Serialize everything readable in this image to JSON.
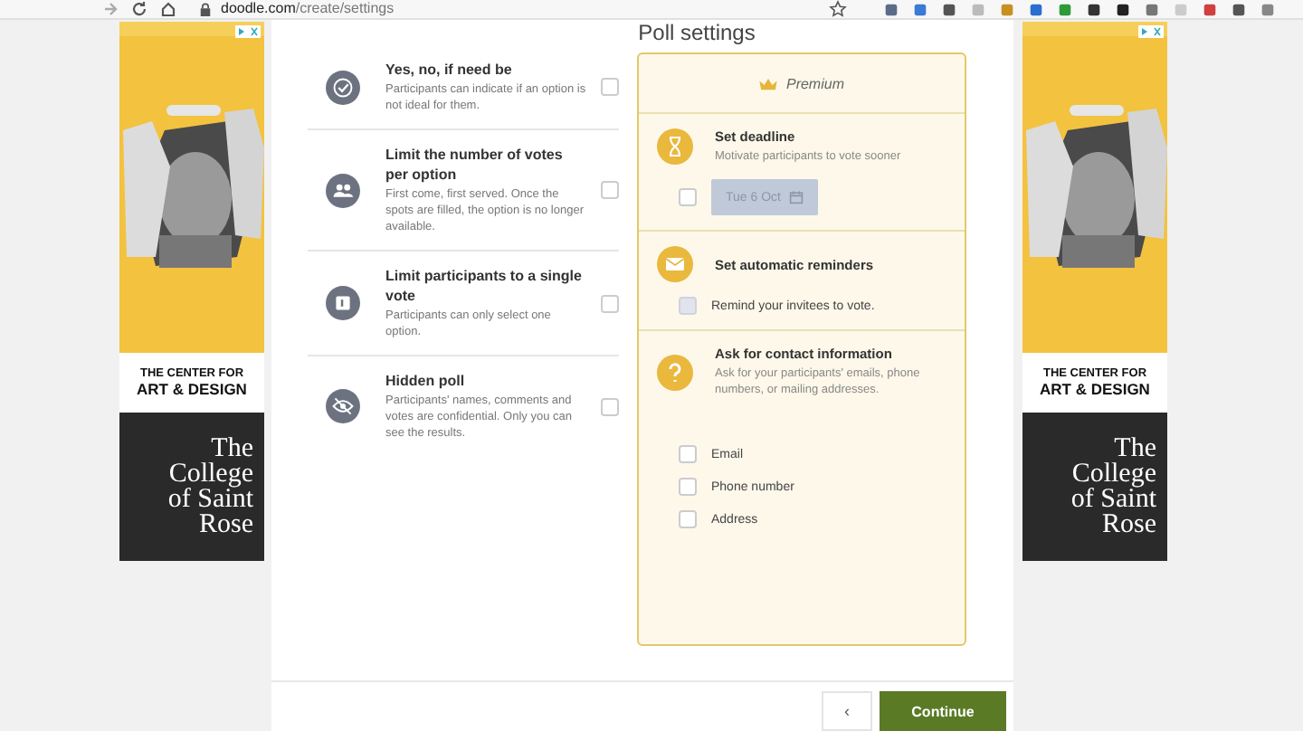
{
  "browser": {
    "url_host": "doodle.com",
    "url_path": "/create/settings"
  },
  "page": {
    "title": "Poll settings"
  },
  "options": [
    {
      "title": "Yes, no, if need be",
      "description": "Participants can indicate if an option is not ideal for them.",
      "checked": false
    },
    {
      "title": "Limit the number of votes per option",
      "description": "First come, first served. Once the spots are filled, the option is no longer available.",
      "checked": false
    },
    {
      "title": "Limit participants to a single vote",
      "description": "Participants can only select one option.",
      "checked": false
    },
    {
      "title": "Hidden poll",
      "description": "Participants' names, comments and votes are confidential. Only you can see the results.",
      "checked": false
    }
  ],
  "premium": {
    "label": "Premium",
    "sections": [
      {
        "kind": "deadline",
        "title": "Set deadline",
        "description": "Motivate participants to vote sooner",
        "checked": false,
        "date": "Tue 6 Oct",
        "date_disabled": true
      },
      {
        "kind": "reminder",
        "title": "Set automatic reminders",
        "checkbox_label": "Remind your invitees to vote.",
        "checked": false,
        "disabled": true
      },
      {
        "kind": "contact",
        "title": "Ask for contact information",
        "description": "Ask for your participants' emails, phone numbers, or mailing addresses.",
        "fields": [
          {
            "label": "Email",
            "checked": false
          },
          {
            "label": "Phone number",
            "checked": false
          },
          {
            "label": "Address",
            "checked": false
          }
        ]
      }
    ]
  },
  "ads": [
    {
      "band_line_1": "THE CENTER FOR",
      "band_line_2": "ART & DESIGN",
      "college_lines": [
        "The",
        "College",
        "of Saint",
        "Rose"
      ]
    },
    {
      "band_line_1": "THE CENTER FOR",
      "band_line_2": "ART & DESIGN",
      "college_lines": [
        "The",
        "College",
        "of Saint",
        "Rose"
      ]
    }
  ],
  "footer": {
    "back": "‹",
    "continue": "Continue"
  }
}
